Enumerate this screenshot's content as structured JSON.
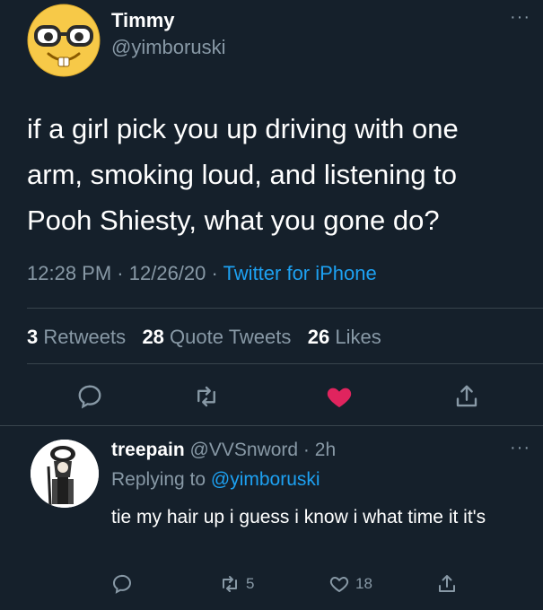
{
  "tweet": {
    "name": "Timmy",
    "handle": "@yimboruski",
    "text": "if a girl pick you up driving with one arm, smoking loud, and listening to Pooh Shiesty, what you gone do?",
    "time": "12:28 PM",
    "date": "12/26/20",
    "source": "Twitter for iPhone",
    "stats": {
      "retweets_count": "3",
      "retweets_label": "Retweets",
      "quotes_count": "28",
      "quotes_label": "Quote Tweets",
      "likes_count": "26",
      "likes_label": "Likes"
    },
    "liked": true,
    "more_label": "···"
  },
  "reply": {
    "name": "treepain",
    "handle": "@VVSnword",
    "age": "2h",
    "replying_to_prefix": "Replying to",
    "replying_to_handle": "@yimboruski",
    "text": "tie my hair up i guess i know i what time it it's",
    "retweets": "5",
    "likes": "18",
    "more_label": "···"
  },
  "colors": {
    "background": "#15202b",
    "muted": "#8899a6",
    "accent": "#1da1f2",
    "like_red": "#e0245e",
    "divider": "#38444d"
  },
  "icons": {
    "avatar_main": "nerd-face-emoji",
    "reply": "comment-bubble-icon",
    "retweet": "retweet-arrows-icon",
    "like": "heart-icon",
    "share": "share-arrow-icon"
  }
}
